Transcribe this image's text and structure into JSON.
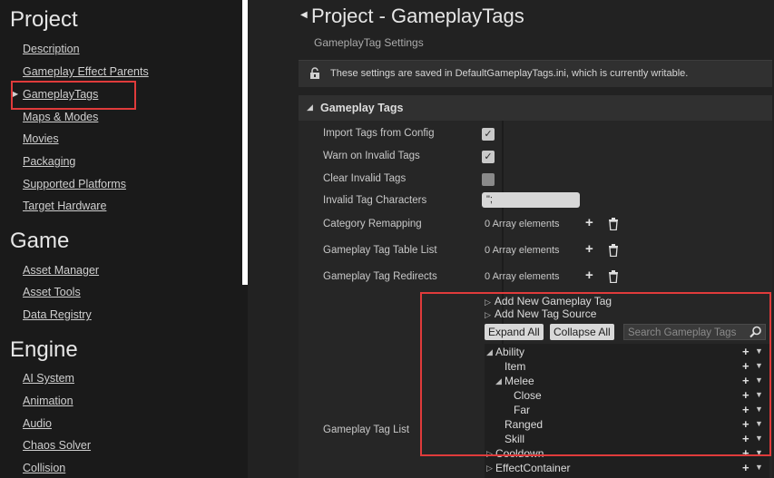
{
  "sidebar": {
    "sections": [
      {
        "title": "Project",
        "items": [
          "Description",
          "Gameplay Effect Parents",
          "GameplayTags",
          "Maps & Modes",
          "Movies",
          "Packaging",
          "Supported Platforms",
          "Target Hardware"
        ]
      },
      {
        "title": "Game",
        "items": [
          "Asset Manager",
          "Asset Tools",
          "Data Registry"
        ]
      },
      {
        "title": "Engine",
        "items": [
          "AI System",
          "Animation",
          "Audio",
          "Chaos Solver",
          "Collision"
        ]
      }
    ],
    "selected": "GameplayTags"
  },
  "header": {
    "title": "Project - GameplayTags",
    "subtitle": "GameplayTag Settings",
    "notice": "These settings are saved in DefaultGameplayTags.ini, which is currently writable."
  },
  "section": {
    "title": "Gameplay Tags"
  },
  "properties": {
    "import_tags": {
      "label": "Import Tags from Config",
      "checked": true
    },
    "warn_invalid": {
      "label": "Warn on Invalid Tags",
      "checked": true
    },
    "clear_invalid": {
      "label": "Clear Invalid Tags",
      "checked": false
    },
    "invalid_chars": {
      "label": "Invalid Tag Characters",
      "value": "\",",
      "chars_display": "\";"
    },
    "category_remap": {
      "label": "Category Remapping",
      "value": "0 Array elements"
    },
    "table_list": {
      "label": "Gameplay Tag Table List",
      "value": "0 Array elements"
    },
    "redirects": {
      "label": "Gameplay Tag Redirects",
      "value": "0 Array elements"
    },
    "tag_list": {
      "label": "Gameplay Tag List"
    }
  },
  "tag_editor": {
    "add_new_tag": "Add New Gameplay Tag",
    "add_new_source": "Add New Tag Source",
    "expand_all": "Expand All",
    "collapse_all": "Collapse All",
    "search_placeholder": "Search Gameplay Tags",
    "tree": [
      {
        "label": "Ability",
        "expanded": true
      },
      {
        "label": "Item"
      },
      {
        "label": "Melee",
        "expanded": true
      },
      {
        "label": "Close"
      },
      {
        "label": "Far"
      },
      {
        "label": "Ranged"
      },
      {
        "label": "Skill"
      },
      {
        "label": "Cooldown",
        "expanded": false
      },
      {
        "label": "EffectContainer",
        "expanded": false
      }
    ]
  },
  "colors": {
    "highlight": "#e03b3b",
    "panel": "#262626",
    "sidebar": "#1a1a1a"
  }
}
